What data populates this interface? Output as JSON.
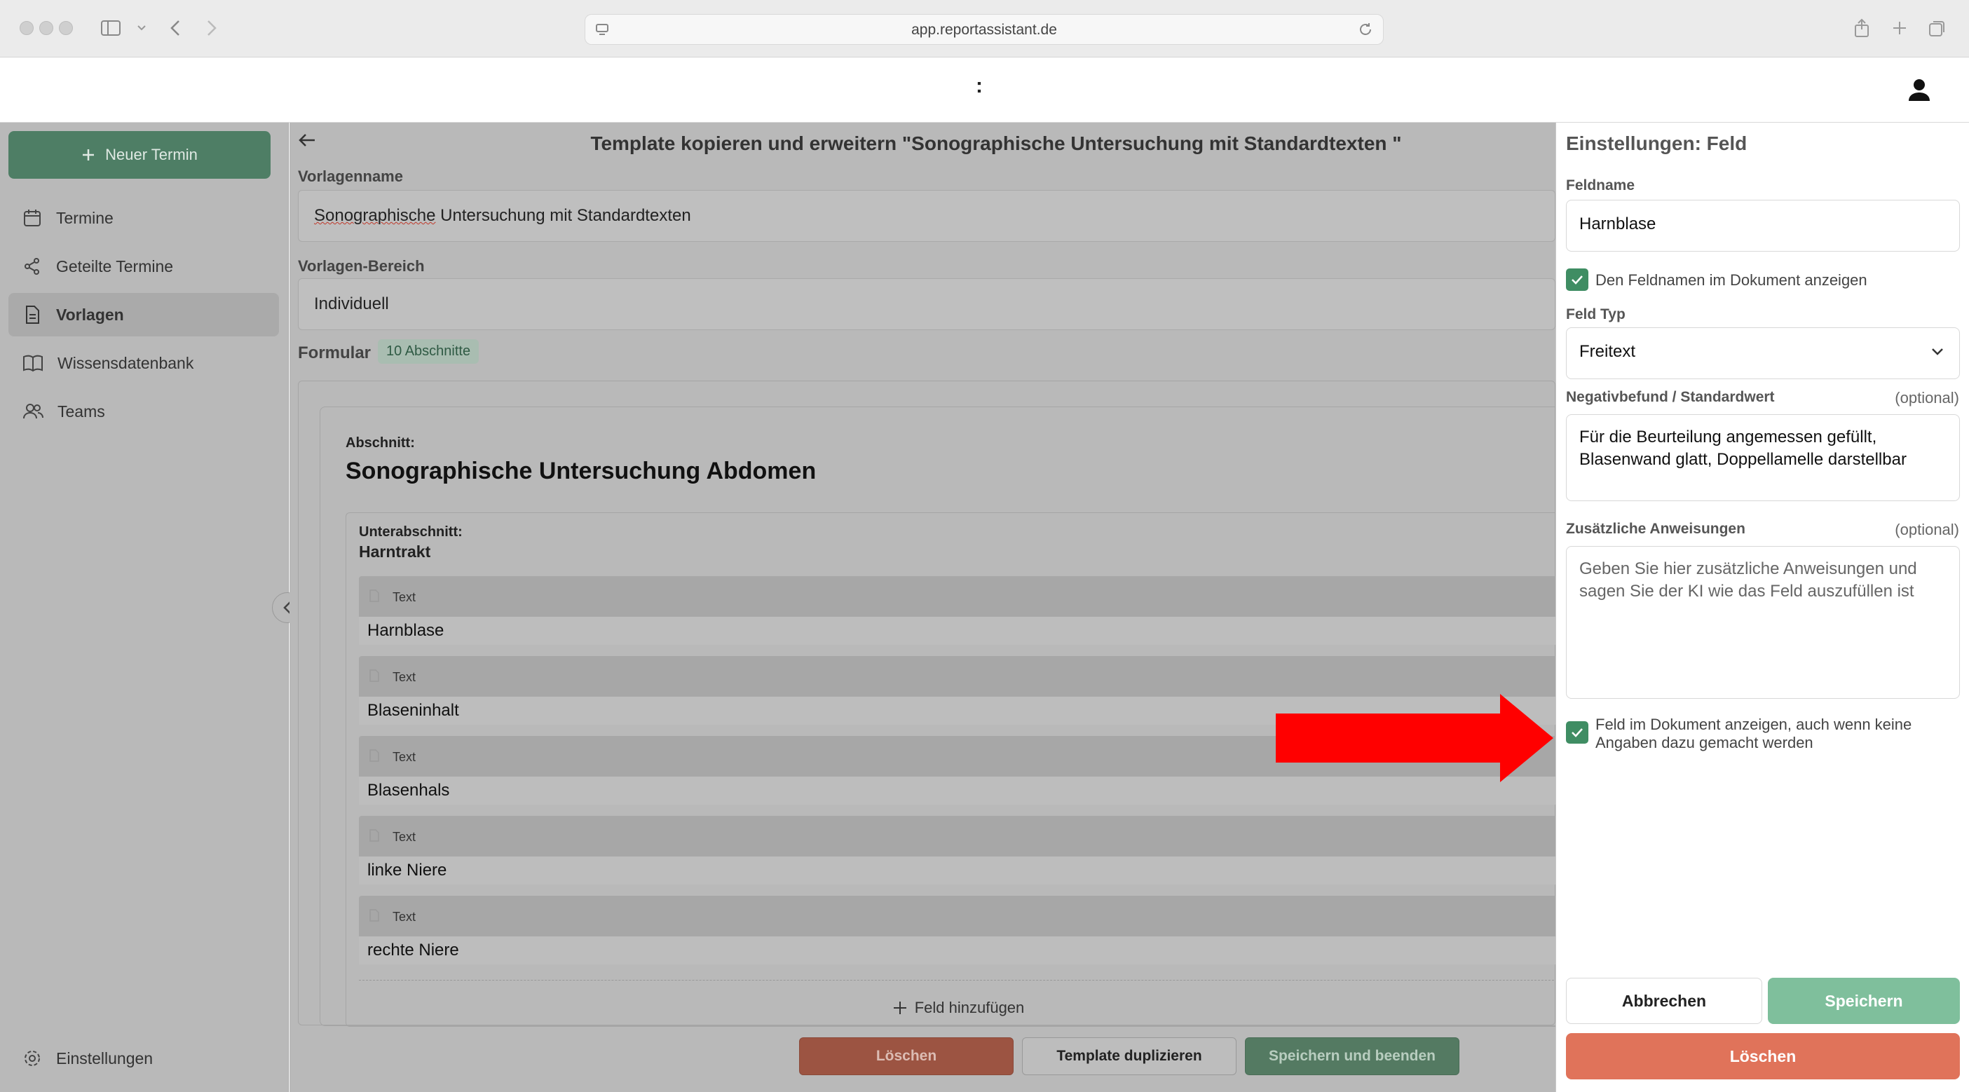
{
  "browser": {
    "url": "app.reportassistant.de"
  },
  "header": {
    "center_text": ":"
  },
  "sidebar": {
    "new_button": "Neuer Termin",
    "items": [
      {
        "label": "Termine",
        "icon": "calendar-icon",
        "active": false
      },
      {
        "label": "Geteilte Termine",
        "icon": "share-icon",
        "active": false
      },
      {
        "label": "Vorlagen",
        "icon": "document-icon",
        "active": true
      },
      {
        "label": "Wissensdatenbank",
        "icon": "book-icon",
        "active": false
      },
      {
        "label": "Teams",
        "icon": "users-icon",
        "active": false
      }
    ],
    "settings": "Einstellungen"
  },
  "main": {
    "title": "Template kopieren und erweitern \"Sonographische Untersuchung mit Standardtexten \"",
    "template_name_label": "Vorlagenname",
    "template_name_prefix": "Sonographische",
    "template_name_rest": " Untersuchung mit Standardtexten",
    "area_label": "Vorlagen-Bereich",
    "area_value": "Individuell",
    "form_label": "Formular",
    "sections_badge": "10 Abschnitte",
    "section_small": "Abschnitt:",
    "section_title": "Sonographische Untersuchung Abdomen",
    "subsection_small": "Unterabschnitt:",
    "subsection_title": "Harntrakt",
    "fields": [
      {
        "type": "Text",
        "name": "Harnblase"
      },
      {
        "type": "Text",
        "name": "Blaseninhalt"
      },
      {
        "type": "Text",
        "name": "Blasenhals"
      },
      {
        "type": "Text",
        "name": "linke Niere"
      },
      {
        "type": "Text",
        "name": "rechte Niere"
      }
    ],
    "add_field": "Feld hinzufügen",
    "footer": {
      "delete": "Löschen",
      "duplicate": "Template duplizieren",
      "save_close": "Speichern und beenden"
    }
  },
  "panel": {
    "title": "Einstellungen: Feld",
    "field_name_label": "Feldname",
    "field_name_value": "Harnblase",
    "show_name_checkbox": "Den Feldnamen im Dokument anzeigen",
    "field_type_label": "Feld Typ",
    "field_type_value": "Freitext",
    "default_label": "Negativbefund / Standardwert",
    "default_optional": "(optional)",
    "default_value": "Für die Beurteilung angemessen gefüllt, Blasenwand glatt, Doppellamelle darstellbar",
    "instructions_label": "Zusätzliche Anweisungen",
    "instructions_optional": "(optional)",
    "instructions_placeholder": "Geben Sie hier zusätzliche Anweisungen und sagen Sie der KI wie das Feld auszufüllen ist",
    "show_empty_checkbox": "Feld im Dokument anzeigen, auch wenn keine Angaben dazu gemacht werden",
    "cancel": "Abbrechen",
    "save": "Speichern",
    "delete": "Löschen"
  },
  "colors": {
    "accent_green": "#4e7e65",
    "checkbox_green": "#3f8d63",
    "delete_orange": "#e0735a",
    "arrow_red": "#ff0000"
  }
}
